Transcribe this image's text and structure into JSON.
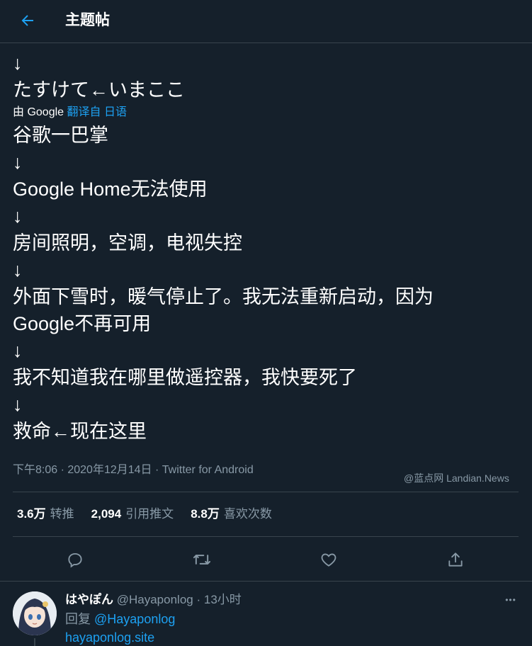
{
  "header": {
    "title": "主题帖"
  },
  "tweet": {
    "lines": [
      "↓",
      "たすけて←いまここ"
    ],
    "translate": {
      "by": "由 Google",
      "link": "翻译自 日语"
    },
    "translated_lines": [
      "谷歌一巴掌",
      "↓",
      "Google Home无法使用",
      "↓",
      "房间照明，空调，电视失控",
      "↓",
      "外面下雪时，暖气停止了。我无法重新启动，因为",
      "Google不再可用",
      "↓",
      "我不知道我在哪里做遥控器，我快要死了",
      "↓",
      "救命←现在这里"
    ],
    "meta": "下午8:06 · 2020年12月14日 · Twitter for Android",
    "watermark": "@蓝点网 Landian.News"
  },
  "stats": {
    "retweets": {
      "count": "3.6万",
      "label": "转推"
    },
    "quotes": {
      "count": "2,094",
      "label": "引用推文"
    },
    "likes": {
      "count": "8.8万",
      "label": "喜欢次数"
    }
  },
  "actions": [
    "reply-icon",
    "retweet-icon",
    "like-icon",
    "share-icon"
  ],
  "reply": {
    "name": "はやぽん",
    "handle": "@Hayaponlog",
    "separator": "·",
    "time": "13小时",
    "reply_prefix": "回复",
    "reply_to": "@Hayaponlog",
    "link": "hayaponlog.site",
    "more": "•••"
  },
  "colors": {
    "background": "#15202b",
    "accent": "#1da1f2",
    "secondary_text": "#8899a6",
    "border": "#38444d"
  }
}
